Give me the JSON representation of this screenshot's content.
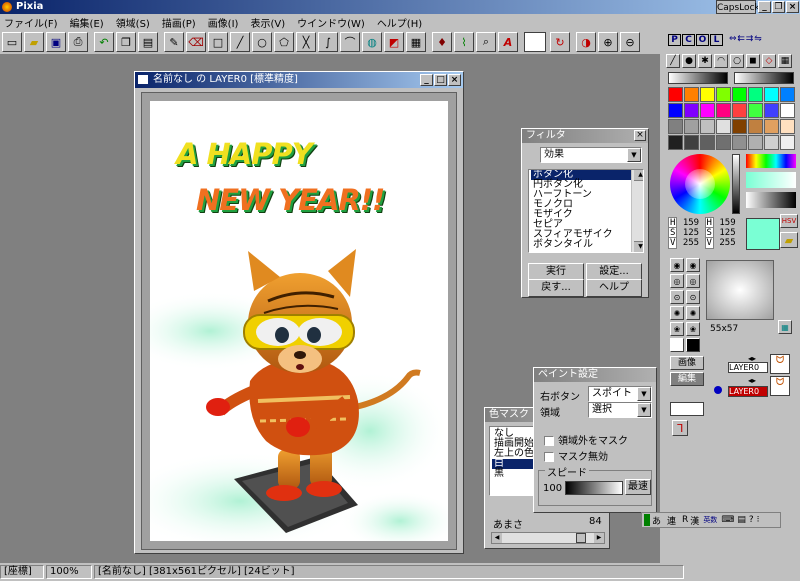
{
  "app": {
    "title": "Pixia",
    "caps_lock": "CapsLock"
  },
  "menu": [
    "ファイル(F)",
    "編集(E)",
    "領域(S)",
    "描画(P)",
    "画像(I)",
    "表示(V)",
    "ウインドウ(W)",
    "ヘルプ(H)"
  ],
  "palette_tabs": [
    "P",
    "C",
    "O",
    "L"
  ],
  "document": {
    "title": "名前なし の LAYER0 [標準精度]",
    "text_line1": "A HAPPY",
    "text_line2": "NEW YEAR!!"
  },
  "filter": {
    "title": "フィルタ",
    "category": "効果",
    "items": [
      "ボタン化",
      "円ボタン化",
      "ハーフトーン",
      "モノクロ",
      "モザイク",
      "セピア",
      "スフィアモザイク",
      "ボタンタイル"
    ],
    "selected_index": 0,
    "buttons": {
      "run": "実行",
      "settings": "設定...",
      "back": "戻す...",
      "help": "ヘルプ"
    }
  },
  "color_mask": {
    "title": "色マスク",
    "items": [
      "なし",
      "描画開始",
      "左上の色",
      "白",
      "黒"
    ],
    "selected_index": 3,
    "amount_label": "あまさ",
    "amount_value": "84"
  },
  "paint_settings": {
    "title": "ペイント設定",
    "right_button_label": "右ボタン",
    "right_button_value": "スポイト",
    "area_label": "領域",
    "area_value": "選択",
    "mask_outside": "領域外をマスク",
    "mask_disable": "マスク無効",
    "speed_label": "スピード",
    "speed_value": "100",
    "max_speed": "最速"
  },
  "hsv": {
    "h1": "159",
    "s1": "125",
    "v1": "255",
    "h2": "159",
    "s2": "125",
    "v2": "255",
    "mode": "HSV"
  },
  "brush_size": "55x57",
  "layers": {
    "tabs": [
      "画像",
      "編集"
    ],
    "items": [
      "LAYER0",
      "LAYER0"
    ]
  },
  "ime": {
    "mode": "あ",
    "conv": "連",
    "r": "R",
    "kanji": "漢",
    "label": "英数"
  },
  "status": {
    "coord": "[座標]",
    "zoom": "100%",
    "info": "[名前なし] [381x561ピクセル] [24ビット]"
  },
  "swatch_colors": [
    [
      "#ff0000",
      "#ff8000",
      "#ffff00",
      "#80ff00",
      "#00ff00",
      "#00ff80",
      "#00ffff",
      "#0080ff"
    ],
    [
      "#0000ff",
      "#8000ff",
      "#ff00ff",
      "#ff0080",
      "#ff4040",
      "#40ff40",
      "#4040ff",
      "#ffffff"
    ],
    [
      "#808080",
      "#a0a0a0",
      "#c0c0c0",
      "#e0e0e0",
      "#804000",
      "#c08040",
      "#e0a060",
      "#ffe0c0"
    ],
    [
      "#202020",
      "#404040",
      "#606060",
      "#707070",
      "#909090",
      "#b0b0b0",
      "#d0d0d0",
      "#f0f0f0"
    ]
  ]
}
